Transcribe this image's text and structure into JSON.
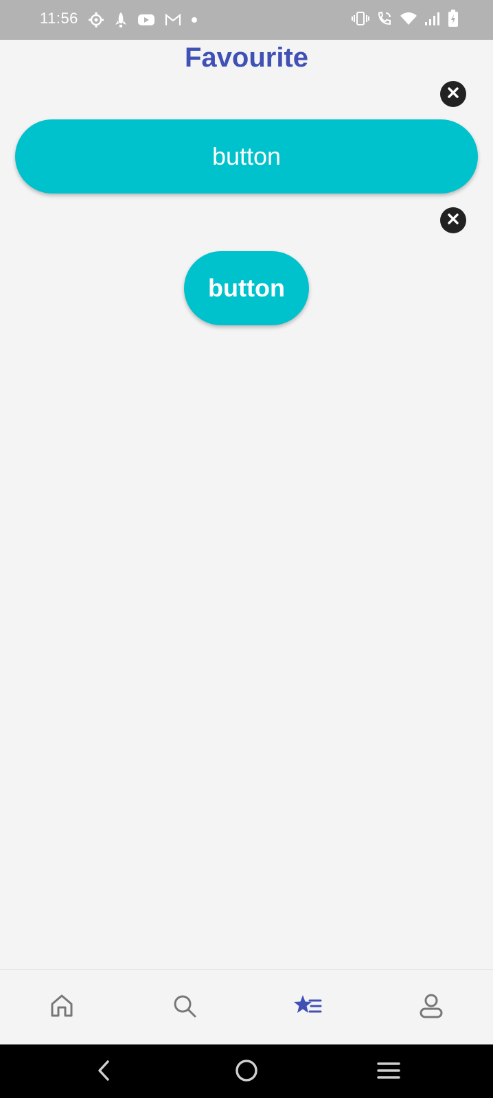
{
  "status_bar": {
    "time": "11:56",
    "left_icons": [
      "settings-gear-icon",
      "rocket-icon",
      "youtube-icon",
      "gmail-icon",
      "notification-dot-icon"
    ],
    "right_icons": [
      "vibrate-icon",
      "wifi-calling-icon",
      "wifi-icon",
      "signal-icon",
      "battery-charging-icon"
    ]
  },
  "header": {
    "title": "Favourite"
  },
  "favourites": [
    {
      "label": "button",
      "remove_icon": "close-icon"
    },
    {
      "label": "button",
      "remove_icon": "close-icon"
    }
  ],
  "bottom_nav": {
    "items": [
      {
        "name": "home",
        "icon": "home-icon",
        "active": false
      },
      {
        "name": "search",
        "icon": "search-icon",
        "active": false
      },
      {
        "name": "favourite",
        "icon": "star-list-icon",
        "active": true
      },
      {
        "name": "profile",
        "icon": "user-icon",
        "active": false
      }
    ]
  },
  "system_nav": {
    "buttons": [
      "back-icon",
      "home-circle-icon",
      "recents-menu-icon"
    ]
  },
  "colors": {
    "accent": "#3f51b5",
    "button": "#00c2cc",
    "close_badge": "#222222",
    "nav_inactive": "#777777",
    "status_bar": "#b3b3b3"
  }
}
